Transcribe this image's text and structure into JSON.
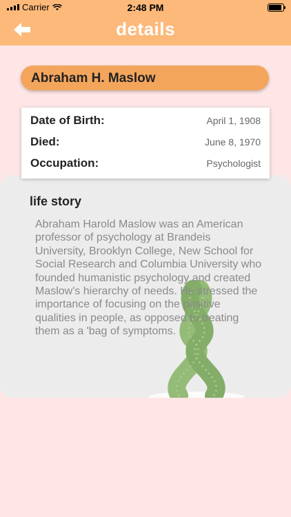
{
  "status_bar": {
    "carrier": "Carrier",
    "time": "2:48 PM"
  },
  "header": {
    "title": "details",
    "back_icon": "back-arrow-icon"
  },
  "person": {
    "name": "Abraham H. Maslow"
  },
  "info": [
    {
      "label": "Date of Birth:",
      "value": "April 1, 1908"
    },
    {
      "label": "Died:",
      "value": "June 8, 1970"
    },
    {
      "label": "Occupation:",
      "value": "Psychologist"
    }
  ],
  "story": {
    "title": "life story",
    "text": "Abraham Harold Maslow was an American professor of psychology at Brandeis University, Brooklyn College, New School for Social Research and Columbia University who founded humanistic psychology and created Maslow's hierarchy of needs. He stressed the importance of focusing on the positive qualities in people, as opposed to treating them as a 'bag of symptoms."
  },
  "colors": {
    "header": "#fcb97a",
    "pill": "#f4a55c",
    "background": "#ffe6e6"
  }
}
